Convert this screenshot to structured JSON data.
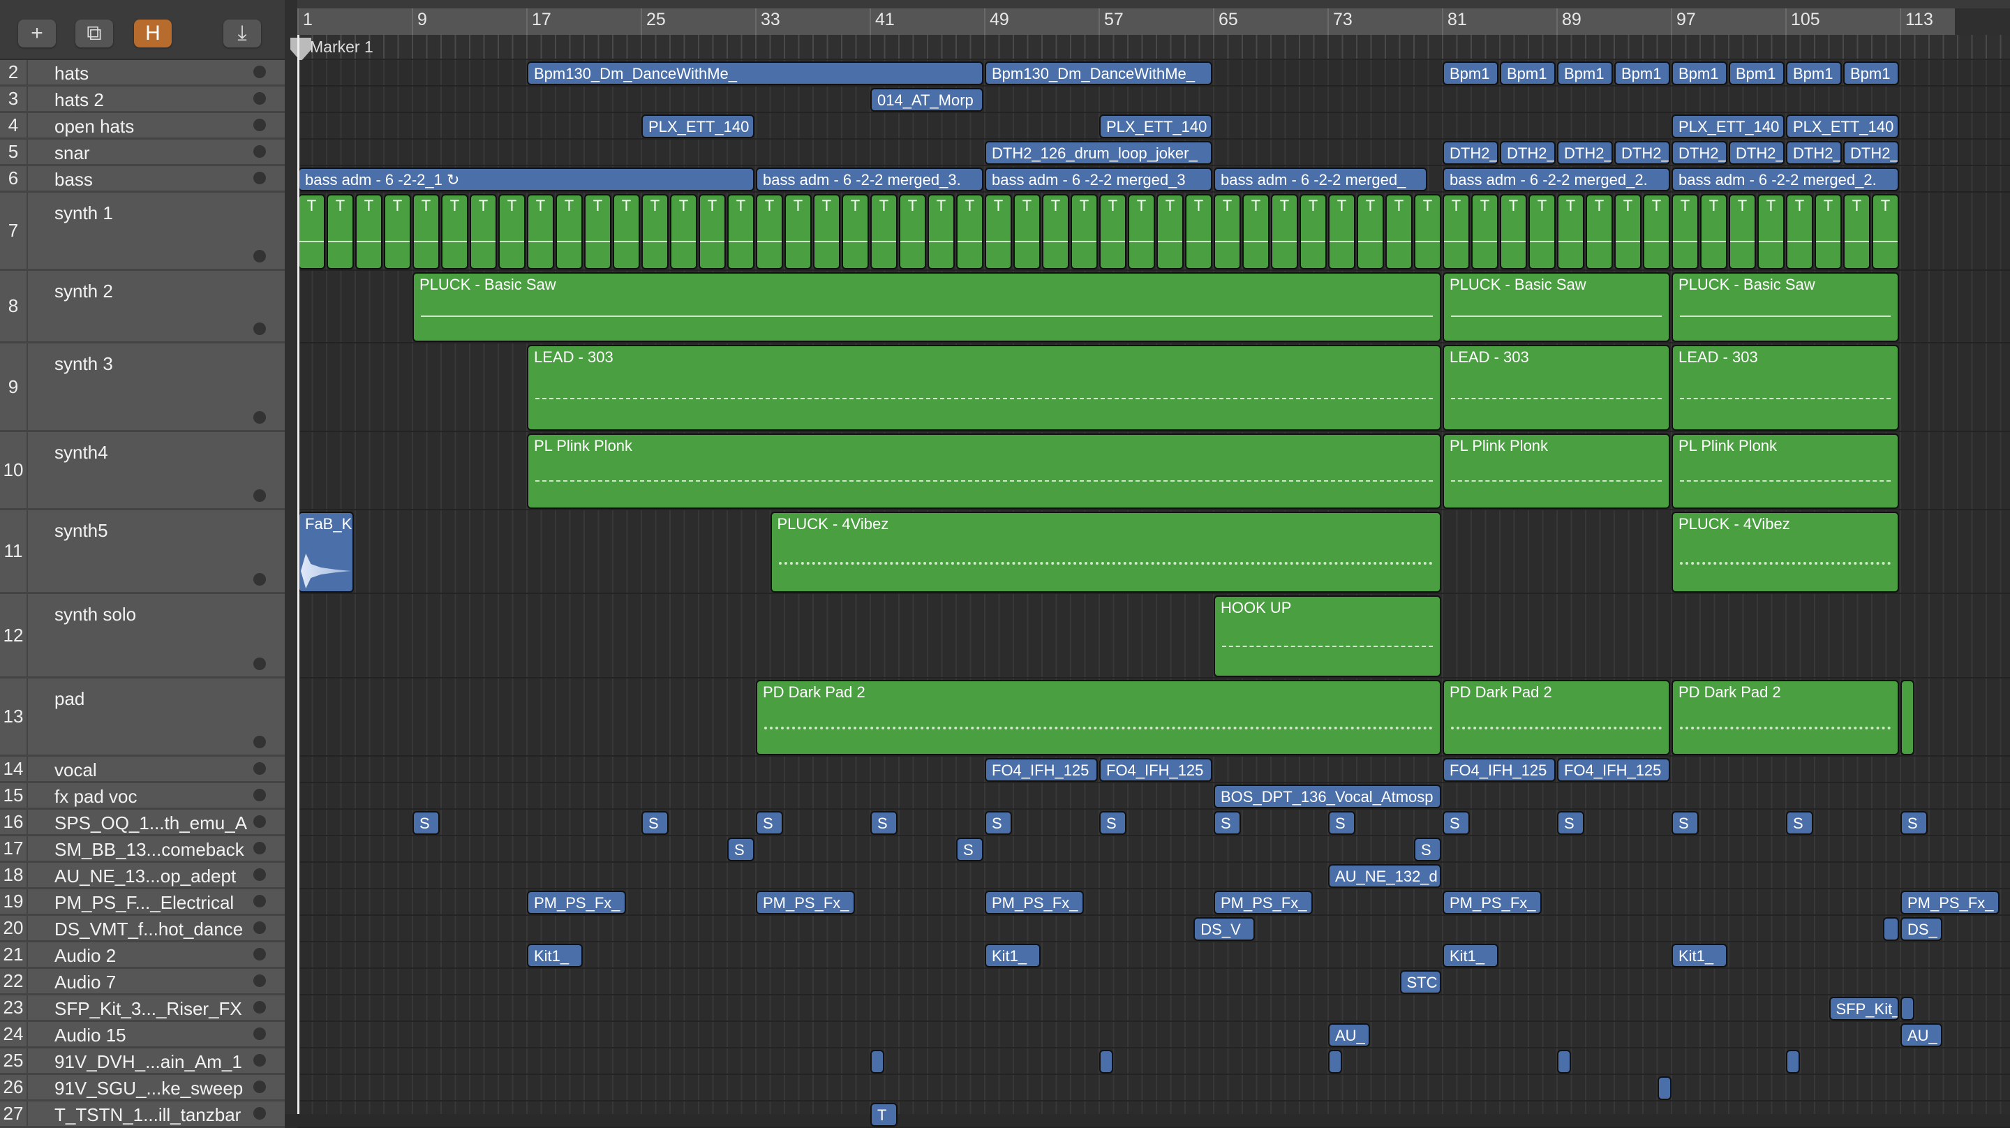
{
  "toolbar": {
    "add_label": "+",
    "duplicate_label": "⧉",
    "h_label": "H",
    "download_label": "⤓"
  },
  "colors": {
    "blue": "#4a6fa9",
    "green": "#4a9f41",
    "orange": "#b76b2c"
  },
  "ruler": [
    1,
    9,
    17,
    25,
    33,
    41,
    49,
    57,
    65,
    73,
    81,
    89,
    97,
    105,
    113
  ],
  "marker": "Marker 1",
  "tracks": [
    {
      "n": "2",
      "name": "hats"
    },
    {
      "n": "3",
      "name": "hats 2"
    },
    {
      "n": "4",
      "name": "open hats"
    },
    {
      "n": "5",
      "name": "snar"
    },
    {
      "n": "6",
      "name": "bass"
    },
    {
      "n": "7",
      "name": "synth 1"
    },
    {
      "n": "8",
      "name": "synth 2"
    },
    {
      "n": "9",
      "name": "synth 3"
    },
    {
      "n": "10",
      "name": "synth4"
    },
    {
      "n": "11",
      "name": "synth5"
    },
    {
      "n": "12",
      "name": "synth solo"
    },
    {
      "n": "13",
      "name": "pad"
    },
    {
      "n": "14",
      "name": "vocal"
    },
    {
      "n": "15",
      "name": "fx pad voc"
    },
    {
      "n": "16",
      "name": "SPS_OQ_1...th_emu_A"
    },
    {
      "n": "17",
      "name": "SM_BB_13...comeback"
    },
    {
      "n": "18",
      "name": "AU_NE_13...op_adept"
    },
    {
      "n": "19",
      "name": "PM_PS_F..._Electrical"
    },
    {
      "n": "20",
      "name": "DS_VMT_f...hot_dance"
    },
    {
      "n": "21",
      "name": "Audio 2"
    },
    {
      "n": "22",
      "name": "Audio 7"
    },
    {
      "n": "23",
      "name": "SFP_Kit_3..._Riser_FX"
    },
    {
      "n": "24",
      "name": "Audio 15"
    },
    {
      "n": "25",
      "name": "91V_DVH_...ain_Am_1"
    },
    {
      "n": "26",
      "name": "91V_SGU_...ke_sweep"
    },
    {
      "n": "27",
      "name": "T_TSTN_1...ill_tanzbar"
    }
  ],
  "repeat_clips": [
    {
      "track": 5,
      "label": "T",
      "start": 1,
      "end": 113,
      "length": 2,
      "color": "green"
    }
  ],
  "regions": [
    [
      0,
      17,
      49,
      "Bpm130_Dm_DanceWithMe_",
      "blue"
    ],
    [
      0,
      49,
      65,
      "Bpm130_Dm_DanceWithMe_",
      "blue"
    ],
    [
      0,
      81,
      85,
      "Bpm1",
      "blue"
    ],
    [
      0,
      85,
      89,
      "Bpm1",
      "blue"
    ],
    [
      0,
      89,
      93,
      "Bpm1",
      "blue"
    ],
    [
      0,
      93,
      97,
      "Bpm1",
      "blue"
    ],
    [
      0,
      97,
      101,
      "Bpm1",
      "blue"
    ],
    [
      0,
      101,
      105,
      "Bpm1",
      "blue"
    ],
    [
      0,
      105,
      109,
      "Bpm1",
      "blue"
    ],
    [
      0,
      109,
      113,
      "Bpm1",
      "blue"
    ],
    [
      1,
      41,
      49,
      "014_AT_Morp",
      "blue"
    ],
    [
      2,
      25,
      33,
      "PLX_ETT_140",
      "blue"
    ],
    [
      2,
      57,
      65,
      "PLX_ETT_140",
      "blue"
    ],
    [
      2,
      97,
      105,
      "PLX_ETT_140",
      "blue"
    ],
    [
      2,
      105,
      113,
      "PLX_ETT_140",
      "blue"
    ],
    [
      3,
      49,
      65,
      "DTH2_126_drum_loop_joker_",
      "blue"
    ],
    [
      3,
      81,
      85,
      "DTH2_",
      "blue"
    ],
    [
      3,
      85,
      89,
      "DTH2_",
      "blue"
    ],
    [
      3,
      89,
      93,
      "DTH2_",
      "blue"
    ],
    [
      3,
      93,
      97,
      "DTH2_",
      "blue"
    ],
    [
      3,
      97,
      101,
      "DTH2_",
      "blue"
    ],
    [
      3,
      101,
      105,
      "DTH2_",
      "blue"
    ],
    [
      3,
      105,
      109,
      "DTH2_",
      "blue"
    ],
    [
      3,
      109,
      113,
      "DTH2_",
      "blue"
    ],
    [
      4,
      1,
      33,
      "bass adm - 6 -2-2_1  ↻",
      "blue"
    ],
    [
      4,
      33,
      49,
      "bass adm - 6 -2-2 merged_3.",
      "blue"
    ],
    [
      4,
      49,
      65,
      "bass adm - 6 -2-2 merged_3",
      "blue"
    ],
    [
      4,
      65,
      80,
      "bass adm - 6 -2-2 merged_",
      "blue"
    ],
    [
      4,
      81,
      97,
      "bass adm - 6 -2-2 merged_2.",
      "blue"
    ],
    [
      4,
      97,
      113,
      "bass adm - 6 -2-2 merged_2.",
      "blue"
    ],
    [
      6,
      9,
      81,
      "PLUCK - Basic Saw",
      "green",
      "line"
    ],
    [
      6,
      81,
      97,
      "PLUCK - Basic Saw",
      "green",
      "line"
    ],
    [
      6,
      97,
      113,
      "PLUCK - Basic Saw",
      "green",
      "line"
    ],
    [
      7,
      17,
      81,
      "LEAD - 303",
      "green",
      "dash"
    ],
    [
      7,
      81,
      97,
      "LEAD - 303",
      "green",
      "dash"
    ],
    [
      7,
      97,
      113,
      "LEAD - 303",
      "green",
      "dash"
    ],
    [
      8,
      17,
      81,
      "PL Plink Plonk",
      "green",
      "dash"
    ],
    [
      8,
      81,
      97,
      "PL Plink Plonk",
      "green",
      "dash"
    ],
    [
      8,
      97,
      113,
      "PL Plink Plonk",
      "green",
      "dash"
    ],
    [
      9,
      1,
      5,
      "FaB_Ki",
      "blue",
      "wave"
    ],
    [
      9,
      34,
      81,
      "PLUCK - 4Vibez",
      "green",
      "dots"
    ],
    [
      9,
      97,
      113,
      "PLUCK - 4Vibez",
      "green",
      "dots"
    ],
    [
      10,
      65,
      81,
      "HOOK UP",
      "green",
      "dash"
    ],
    [
      11,
      33,
      81,
      "PD Dark Pad 2",
      "green",
      "dots"
    ],
    [
      11,
      81,
      97,
      "PD Dark Pad 2",
      "green",
      "dots"
    ],
    [
      11,
      97,
      113,
      "PD Dark Pad 2",
      "green",
      "dots"
    ],
    [
      11,
      113,
      114,
      "",
      "green"
    ],
    [
      12,
      49,
      57,
      "FO4_IFH_125",
      "blue"
    ],
    [
      12,
      57,
      65,
      "FO4_IFH_125",
      "blue"
    ],
    [
      12,
      81,
      89,
      "FO4_IFH_125",
      "blue"
    ],
    [
      12,
      89,
      97,
      "FO4_IFH_125",
      "blue"
    ],
    [
      13,
      65,
      81,
      "BOS_DPT_136_Vocal_Atmosp",
      "blue"
    ],
    [
      14,
      9,
      11,
      "S",
      "blue"
    ],
    [
      14,
      25,
      27,
      "S",
      "blue"
    ],
    [
      14,
      33,
      35,
      "S",
      "blue"
    ],
    [
      14,
      41,
      43,
      "S",
      "blue"
    ],
    [
      14,
      49,
      51,
      "S",
      "blue"
    ],
    [
      14,
      57,
      59,
      "S",
      "blue"
    ],
    [
      14,
      65,
      67,
      "S",
      "blue"
    ],
    [
      14,
      73,
      75,
      "S",
      "blue"
    ],
    [
      14,
      81,
      83,
      "S",
      "blue"
    ],
    [
      14,
      89,
      91,
      "S",
      "blue"
    ],
    [
      14,
      97,
      99,
      "S",
      "blue"
    ],
    [
      14,
      105,
      107,
      "S",
      "blue"
    ],
    [
      14,
      113,
      115,
      "S",
      "blue"
    ],
    [
      15,
      31,
      33,
      "S",
      "blue"
    ],
    [
      15,
      47,
      49,
      "S",
      "blue"
    ],
    [
      15,
      79,
      81,
      "S",
      "blue"
    ],
    [
      16,
      73,
      81,
      "AU_NE_132_d",
      "blue"
    ],
    [
      17,
      17,
      24,
      "PM_PS_Fx_",
      "blue"
    ],
    [
      17,
      33,
      40,
      "PM_PS_Fx_",
      "blue"
    ],
    [
      17,
      49,
      56,
      "PM_PS_Fx_",
      "blue"
    ],
    [
      17,
      65,
      72,
      "PM_PS_Fx_",
      "blue"
    ],
    [
      17,
      81,
      88,
      "PM_PS_Fx_",
      "blue"
    ],
    [
      17,
      113,
      120,
      "PM_PS_Fx_",
      "blue"
    ],
    [
      18,
      63.6,
      68,
      "DS_V",
      "blue"
    ],
    [
      18,
      111.8,
      113,
      "",
      "blue"
    ],
    [
      18,
      113,
      116,
      "DS_",
      "blue"
    ],
    [
      19,
      17,
      21,
      "Kit1_",
      "blue"
    ],
    [
      19,
      49,
      53,
      "Kit1_",
      "blue"
    ],
    [
      19,
      81,
      85,
      "Kit1_",
      "blue"
    ],
    [
      19,
      97,
      101,
      "Kit1_",
      "blue"
    ],
    [
      20,
      78,
      81,
      "STC",
      "blue"
    ],
    [
      21,
      108,
      113,
      "SFP_Kit_",
      "blue"
    ],
    [
      21,
      113,
      113.8,
      "",
      "blue"
    ],
    [
      22,
      73,
      76,
      "AU_",
      "blue"
    ],
    [
      22,
      113,
      116,
      "AU_",
      "blue"
    ],
    [
      23,
      41,
      42,
      "",
      "blue"
    ],
    [
      23,
      57,
      58,
      "",
      "blue"
    ],
    [
      23,
      73,
      74,
      "",
      "blue"
    ],
    [
      23,
      89,
      90,
      "",
      "blue"
    ],
    [
      23,
      105,
      106,
      "",
      "blue"
    ],
    [
      24,
      96,
      97,
      "",
      "blue"
    ],
    [
      25,
      41,
      43,
      "T",
      "blue"
    ]
  ]
}
